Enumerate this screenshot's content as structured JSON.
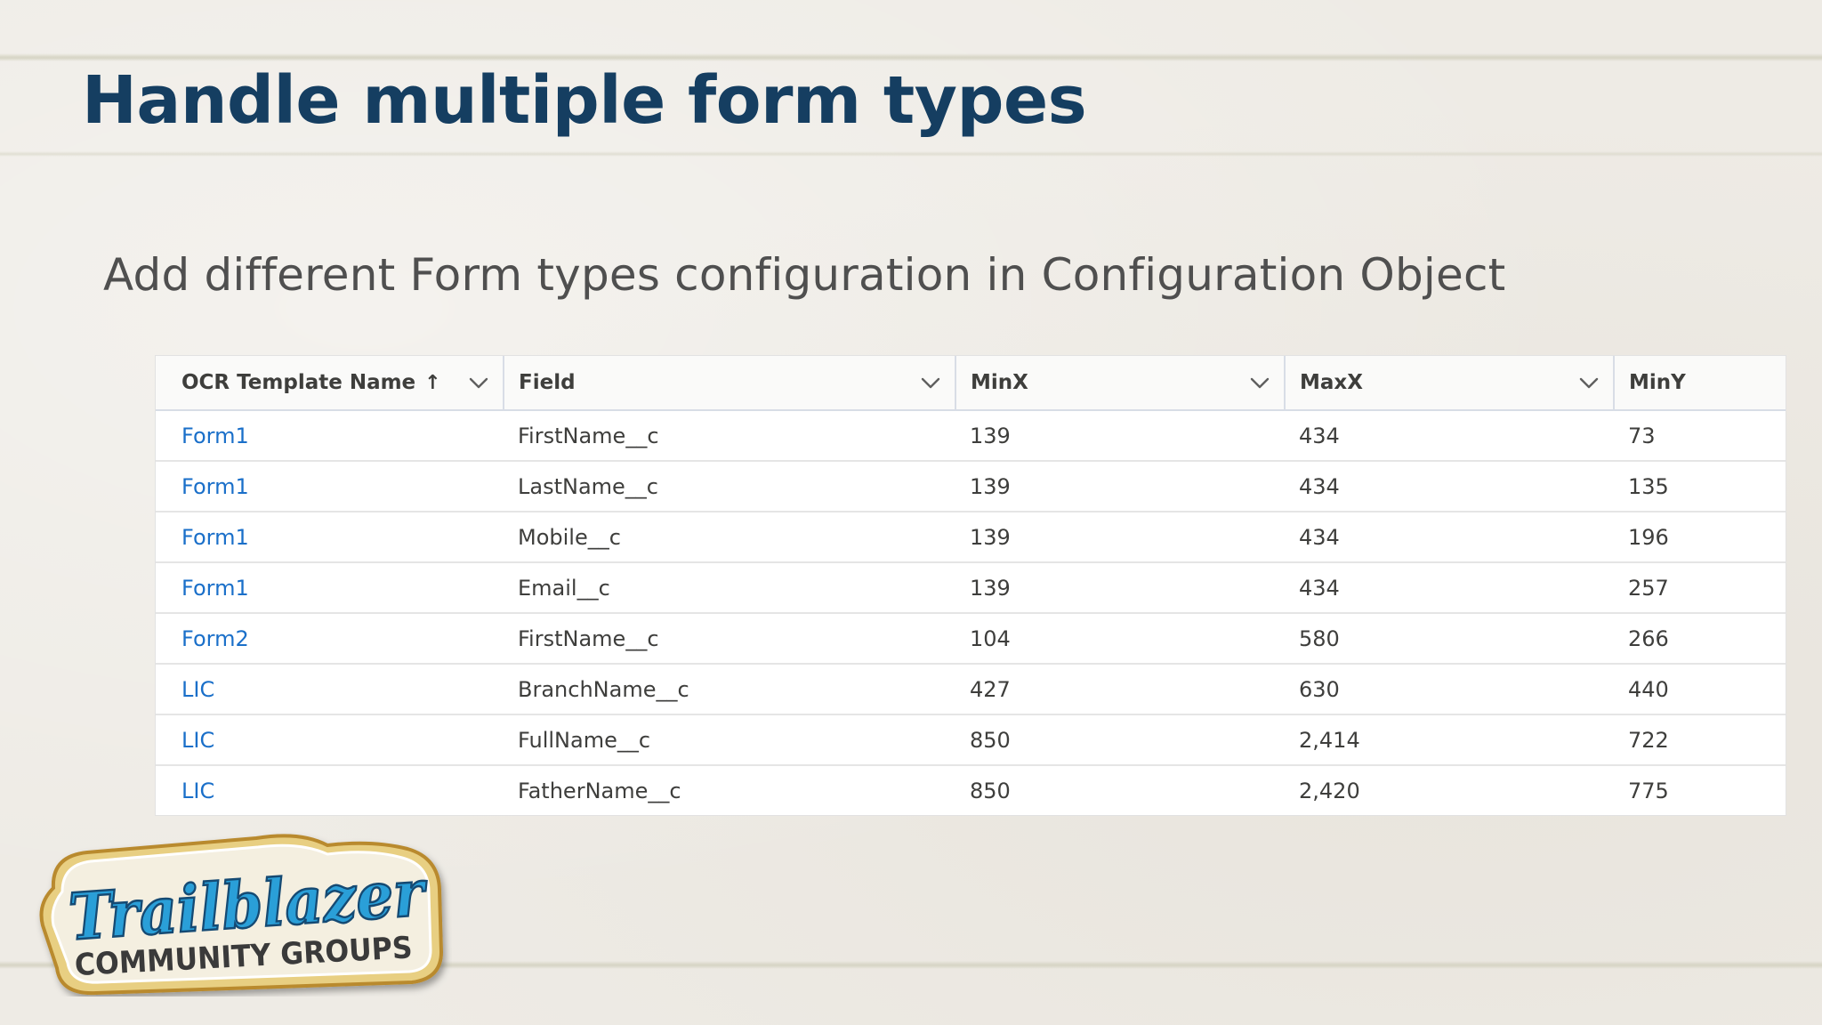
{
  "slide": {
    "title": "Handle multiple form types",
    "subtitle": "Add different Form types configuration in Configuration Object"
  },
  "table": {
    "columns": [
      {
        "label": "OCR Template Name",
        "sort_icon": "arrow-up-icon",
        "menu_icon": "chevron-down-icon"
      },
      {
        "label": "Field",
        "menu_icon": "chevron-down-icon"
      },
      {
        "label": "MinX",
        "menu_icon": "chevron-down-icon"
      },
      {
        "label": "MaxX",
        "menu_icon": "chevron-down-icon"
      },
      {
        "label": "MinY"
      }
    ],
    "rows": [
      {
        "template": "Form1",
        "field": "FirstName__c",
        "minx": "139",
        "maxx": "434",
        "miny": "73"
      },
      {
        "template": "Form1",
        "field": "LastName__c",
        "minx": "139",
        "maxx": "434",
        "miny": "135"
      },
      {
        "template": "Form1",
        "field": "Mobile__c",
        "minx": "139",
        "maxx": "434",
        "miny": "196"
      },
      {
        "template": "Form1",
        "field": "Email__c",
        "minx": "139",
        "maxx": "434",
        "miny": "257"
      },
      {
        "template": "Form2",
        "field": "FirstName__c",
        "minx": "104",
        "maxx": "580",
        "miny": "266"
      },
      {
        "template": "LIC",
        "field": "BranchName__c",
        "minx": "427",
        "maxx": "630",
        "miny": "440"
      },
      {
        "template": "LIC",
        "field": "FullName__c",
        "minx": "850",
        "maxx": "2,414",
        "miny": "722"
      },
      {
        "template": "LIC",
        "field": "FatherName__c",
        "minx": "850",
        "maxx": "2,420",
        "miny": "775"
      }
    ]
  },
  "logo": {
    "line1": "Trailblazer",
    "line2": "COMMUNITY GROUPS"
  },
  "colors": {
    "title": "#153e61",
    "subtitle": "#4f4f4f",
    "link": "#1a6fc9",
    "logo_blue": "#2a9fd8",
    "logo_border": "#c9a24a"
  }
}
